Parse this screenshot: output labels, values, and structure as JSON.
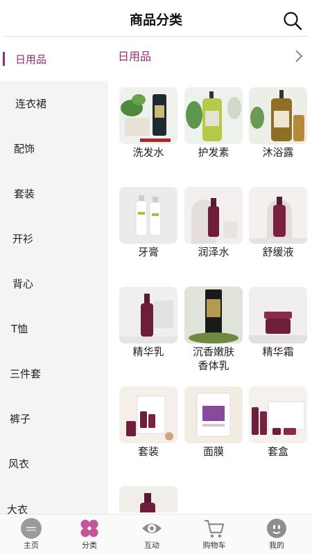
{
  "header": {
    "title": "商品分类"
  },
  "sidebar": {
    "items": [
      {
        "label": "日用品",
        "active": true
      },
      {
        "label": "连衣裙"
      },
      {
        "label": "配饰"
      },
      {
        "label": "套装"
      },
      {
        "label": "开衫"
      },
      {
        "label": "背心"
      },
      {
        "label": "T恤"
      },
      {
        "label": "三件套"
      },
      {
        "label": "裤子"
      },
      {
        "label": "风衣"
      },
      {
        "label": "大衣"
      }
    ]
  },
  "section": {
    "title": "日用品"
  },
  "products": [
    {
      "name": "洗发水",
      "icon": "shampoo-bottle"
    },
    {
      "name": "护发素",
      "icon": "conditioner-bottle"
    },
    {
      "name": "沐浴露",
      "icon": "body-wash-bottle"
    },
    {
      "name": "牙膏",
      "icon": "toothpaste-tube"
    },
    {
      "name": "润泽水",
      "icon": "toner-bottle"
    },
    {
      "name": "舒缓液",
      "icon": "soothing-bottle"
    },
    {
      "name": "精华乳",
      "icon": "essence-bottle"
    },
    {
      "name": "沉香嫩肤香体乳",
      "icon": "lotion-tube"
    },
    {
      "name": "精华霜",
      "icon": "cream-jar"
    },
    {
      "name": "套装",
      "icon": "skincare-set"
    },
    {
      "name": "面膜",
      "icon": "face-mask"
    },
    {
      "name": "套盒",
      "icon": "gift-box"
    },
    {
      "name": "",
      "icon": "serum-bottle"
    }
  ],
  "tabbar": {
    "items": [
      {
        "label": "主页",
        "icon": "home-logo-icon"
      },
      {
        "label": "分类",
        "icon": "category-icon",
        "active": true
      },
      {
        "label": "互动",
        "icon": "interact-icon"
      },
      {
        "label": "购物车",
        "icon": "cart-icon"
      },
      {
        "label": "我的",
        "icon": "profile-icon"
      }
    ]
  },
  "colors": {
    "accent": "#9c2a73",
    "sidebar_bg": "#f4f4f4",
    "product_wine": "#6e1d3b"
  }
}
